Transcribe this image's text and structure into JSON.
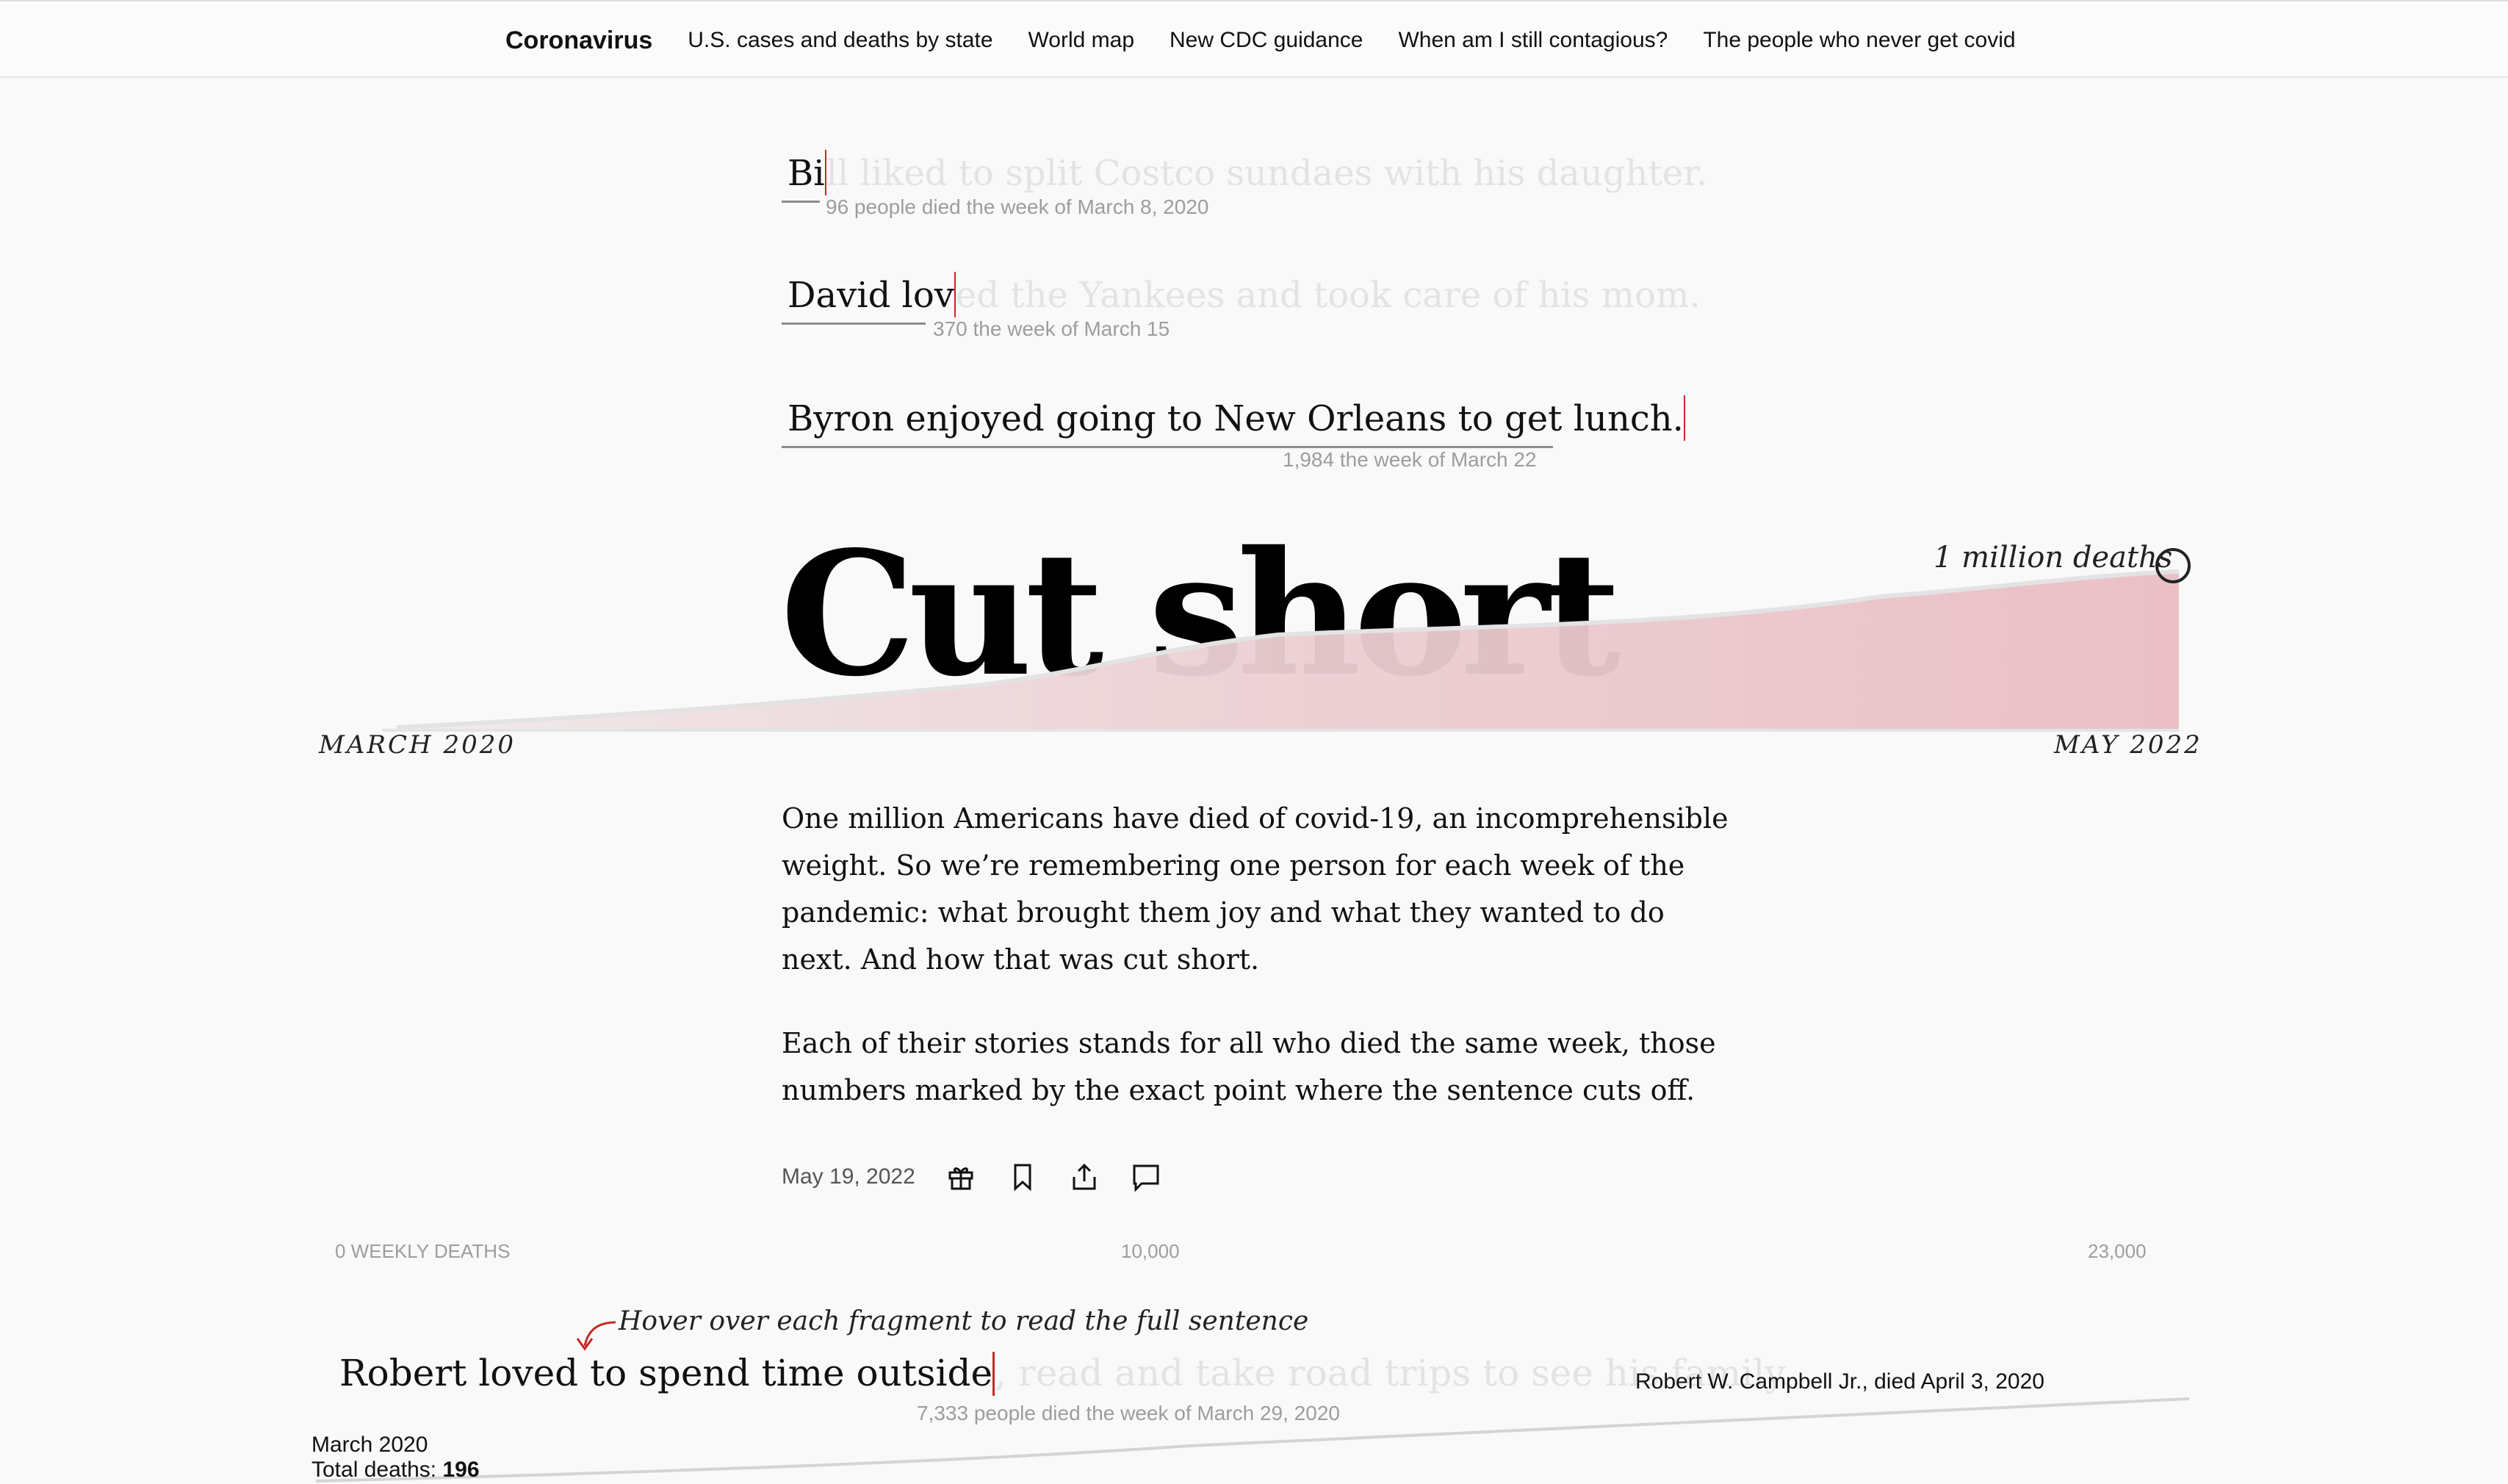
{
  "nav": {
    "brand": "Coronavirus",
    "links": [
      "U.S. cases and deaths by state",
      "World map",
      "New CDC guidance",
      "When am I still contagious?",
      "The people who never get covid"
    ]
  },
  "fragments": [
    {
      "visible": "Bi",
      "hidden": "ll liked to split Costco sundaes with his daughter.",
      "note": "96 people died the week of March 8, 2020"
    },
    {
      "visible": "David lov",
      "hidden": "ed the Yankees and took care of his mom.",
      "note": "370 the week of March 15"
    },
    {
      "visible": "Byron enjoyed going to New Orleans to get lunch.",
      "hidden": "",
      "note": "1,984 the week of March 22"
    }
  ],
  "title": "Cut short",
  "chart_data": {
    "type": "area",
    "annotations": {
      "start": "MARCH 2020",
      "end": "MAY 2022",
      "peak": "1 million deaths"
    },
    "ylim": [
      0,
      1000000
    ]
  },
  "intro": {
    "p1": "One million Americans have died of covid-19, an incomprehensible weight. So we’re remembering one person for each week of the pandemic: what brought them joy and what they wanted to do next. And how that was cut short.",
    "p2": "Each of their stories stands for all who died the same week, those numbers marked by the exact point where the sentence cuts off."
  },
  "meta": {
    "date": "May 19, 2022",
    "icons": [
      "gift-icon",
      "bookmark-icon",
      "share-icon",
      "comment-icon"
    ]
  },
  "axis": {
    "left": "0 WEEKLY DEATHS",
    "mid": "10,000",
    "right": "23,000"
  },
  "hint": "Hover over each fragment to read the full sentence",
  "robert": {
    "visible": "Robert loved to spend time outside",
    "hidden": ", read and take road trips to see his family.",
    "name": "Robert W. Campbell Jr., died April 3, 2020",
    "note": "7,333 people died the week of March 29, 2020"
  },
  "bottom": {
    "month": "March 2020",
    "total_label": "Total deaths:",
    "total_value": "196"
  }
}
